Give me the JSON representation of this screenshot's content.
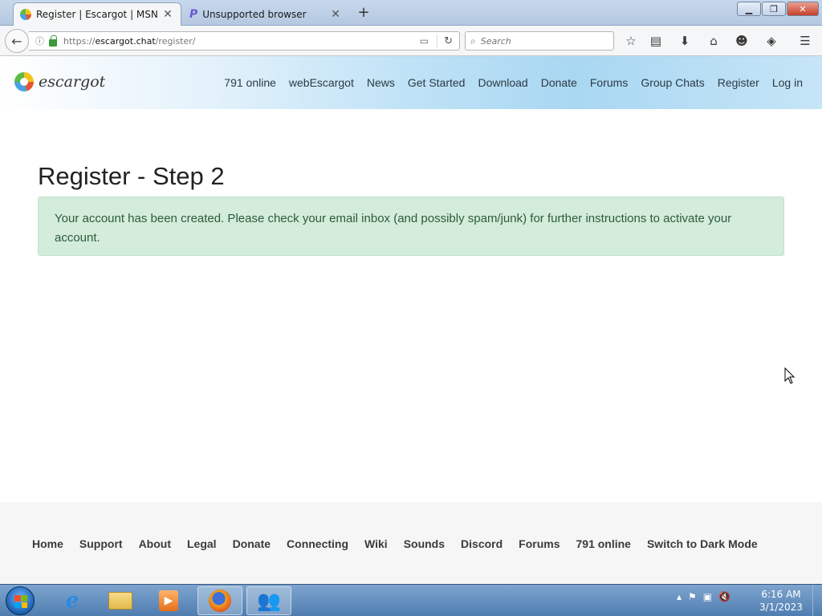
{
  "browser": {
    "tabs": [
      {
        "title": "Register | Escargot | MSN ...",
        "active": true
      },
      {
        "title": "Unsupported browser",
        "active": false
      }
    ],
    "url": {
      "prefix": "https://",
      "domain": "escargot.chat",
      "path": "/register/"
    },
    "search_placeholder": "Search"
  },
  "site": {
    "logo_text": "escargot",
    "nav": [
      "791 online",
      "webEscargot",
      "News",
      "Get Started",
      "Download",
      "Donate",
      "Forums",
      "Group Chats",
      "Register",
      "Log in"
    ]
  },
  "main": {
    "title": "Register - Step 2",
    "alert": "Your account has been created. Please check your email inbox (and possibly spam/junk) for further instructions to activate your account."
  },
  "footer": {
    "links": [
      "Home",
      "Support",
      "About",
      "Legal",
      "Donate",
      "Connecting",
      "Wiki",
      "Sounds",
      "Discord",
      "Forums",
      "791 online",
      "Switch to Dark Mode"
    ]
  },
  "taskbar": {
    "time": "6:16 AM",
    "date": "3/1/2023"
  },
  "colors": {
    "alert_bg": "#d4ecdb",
    "alert_text": "#2d5b3a",
    "header_accent": "#a9d7f2"
  }
}
